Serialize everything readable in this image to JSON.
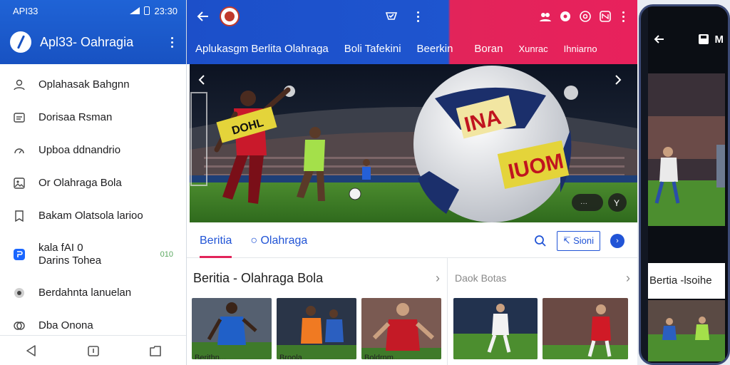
{
  "status_bar": {
    "carrier": "API33",
    "time": "23:30"
  },
  "drawer": {
    "app_title": "Apl33- Oahragia",
    "items": [
      {
        "label": "Oplahasak Bahgnn",
        "icon": "user-icon"
      },
      {
        "label": "Dorisaa Rsman",
        "icon": "message-icon"
      },
      {
        "label": "Upboa ddnandrio",
        "icon": "gauge-icon"
      },
      {
        "label": "Or Olahraga Bola",
        "icon": "image-icon"
      },
      {
        "label": "Bakam Olatsola larioo",
        "icon": "bookmark-icon"
      },
      {
        "label": "kala fAI 0",
        "label2": "Darins Tohea",
        "badge": "010",
        "icon": "link-icon"
      },
      {
        "label": "Berdahnta lanuelan",
        "icon": "settings-icon"
      },
      {
        "label": "Dba Onona",
        "icon": "chat-icon"
      }
    ]
  },
  "topbar": {
    "tabs": [
      "Aplukasgm Berlita Olahraga",
      "Boli Tafekini",
      "Beerkin",
      "Boran",
      "Xunrac",
      "Ihniarno"
    ]
  },
  "hero": {
    "shirt_text": "DOHL",
    "ball_text_1": "INA",
    "ball_text_2": "IUOM",
    "badge_text": "···",
    "badge_right": "Y"
  },
  "section_tabs": {
    "tab_1": "Beritia",
    "tab_2": "Olahraga",
    "follow_label": "Sioni",
    "share_label": "›"
  },
  "news_left": {
    "title": "Beritia - Olahraga Bola",
    "cards": [
      "Berithn...",
      "Broola",
      "Boldrnm..."
    ]
  },
  "news_right": {
    "title": "Daok Botas",
    "cards": [
      "",
      ""
    ]
  },
  "phone": {
    "caption": "Bertia -lsoihe",
    "header_label": "M"
  },
  "colors": {
    "primary": "#1c4fc9",
    "accent": "#e2245a"
  }
}
